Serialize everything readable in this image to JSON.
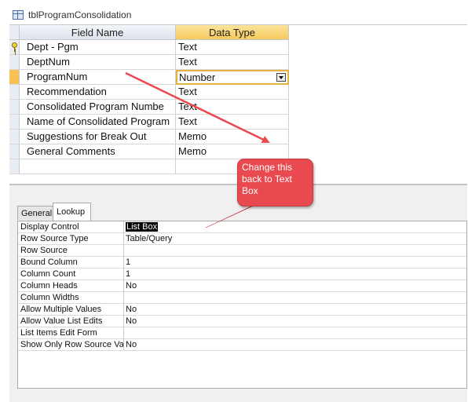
{
  "window": {
    "title": "tblProgramConsolidation"
  },
  "grid": {
    "headers": {
      "field_name": "Field Name",
      "data_type": "Data Type"
    },
    "rows": [
      {
        "name": "Dept - Pgm",
        "type": "Text",
        "primary_key": true
      },
      {
        "name": "DeptNum",
        "type": "Text"
      },
      {
        "name": "ProgramNum",
        "type": "Number",
        "selected": true
      },
      {
        "name": "Recommendation",
        "type": "Text"
      },
      {
        "name": "Consolidated Program Numbe",
        "type": "Text"
      },
      {
        "name": "Name of Consolidated Program",
        "type": "Text"
      },
      {
        "name": "Suggestions for Break Out",
        "type": "Memo"
      },
      {
        "name": "General Comments",
        "type": "Memo"
      }
    ]
  },
  "properties": {
    "tabs": [
      "General",
      "Lookup"
    ],
    "active_tab": "Lookup",
    "rows": [
      {
        "label": "Display Control",
        "value": "List Box"
      },
      {
        "label": "Row Source Type",
        "value": "Table/Query"
      },
      {
        "label": "Row Source",
        "value": ""
      },
      {
        "label": "Bound Column",
        "value": "1"
      },
      {
        "label": "Column Count",
        "value": "1"
      },
      {
        "label": "Column Heads",
        "value": "No"
      },
      {
        "label": "Column Widths",
        "value": ""
      },
      {
        "label": "Allow Multiple Values",
        "value": "No"
      },
      {
        "label": "Allow Value List Edits",
        "value": "No"
      },
      {
        "label": "List Items Edit Form",
        "value": ""
      },
      {
        "label": "Show Only Row Source Values",
        "value": "No"
      }
    ]
  },
  "callout": {
    "text": "Change this back to Text Box"
  },
  "colors": {
    "annotation_red": "#e94a4f",
    "header_highlight": "#f6c95c",
    "selected_border": "#e3b23c"
  }
}
